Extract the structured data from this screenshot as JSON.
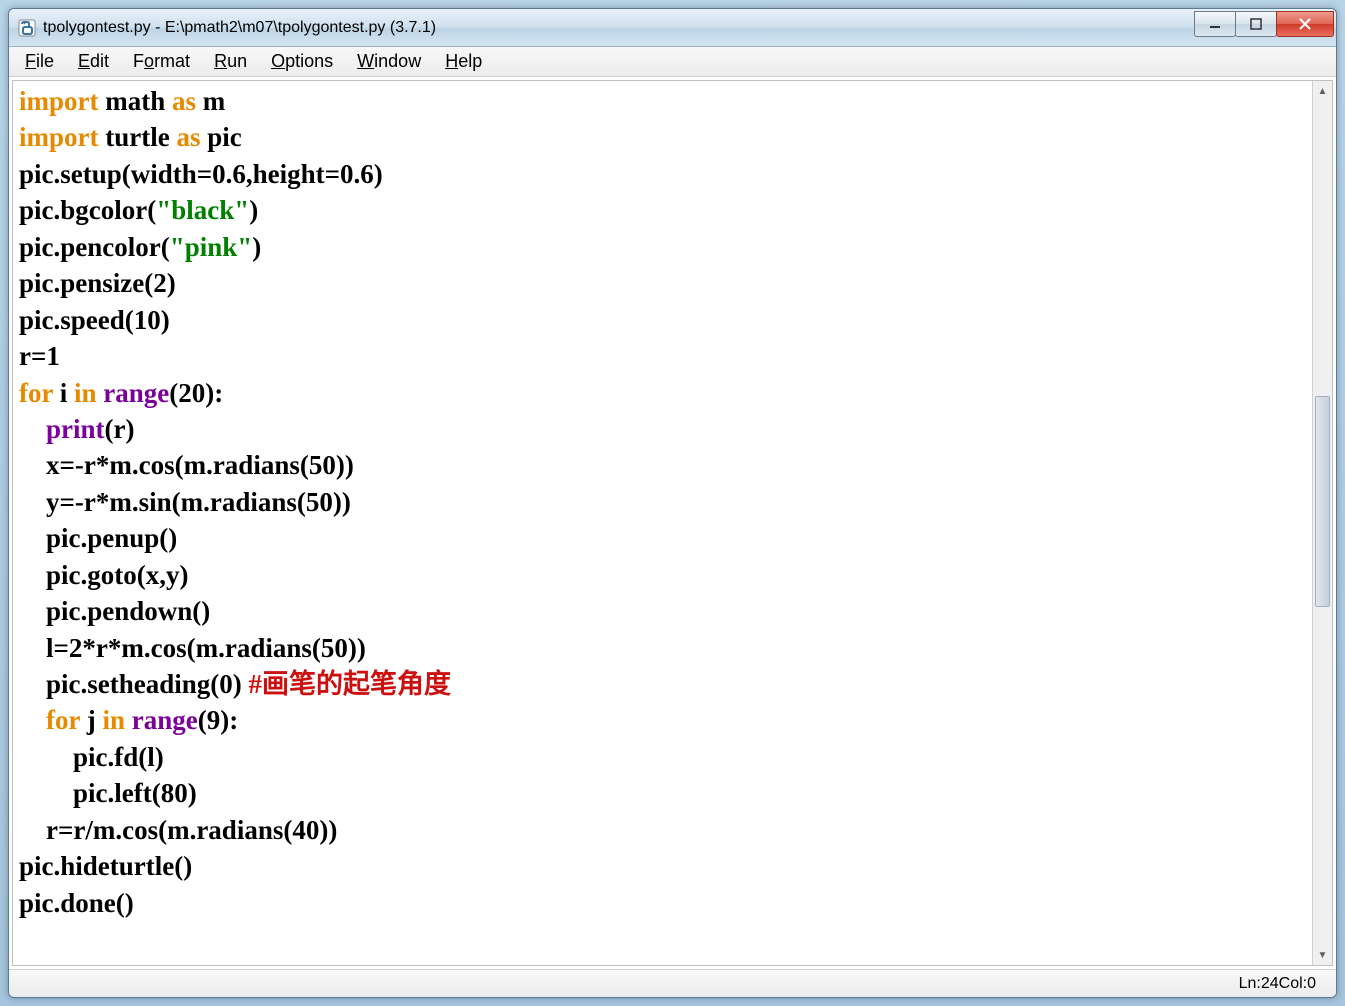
{
  "window": {
    "title": "tpolygontest.py - E:\\pmath2\\m07\\tpolygontest.py (3.7.1)"
  },
  "menu": {
    "file": "File",
    "edit": "Edit",
    "format": "Format",
    "run": "Run",
    "options": "Options",
    "window": "Window",
    "help": "Help"
  },
  "code": {
    "l1_import": "import",
    "l1_math": " math ",
    "l1_as": "as",
    "l1_m": " m",
    "l2_import": "import",
    "l2_turtle": " turtle ",
    "l2_as": "as",
    "l2_pic": " pic",
    "l3": "pic.setup(width=0.6,height=0.6)",
    "l4_a": "pic.bgcolor(",
    "l4_str": "\"black\"",
    "l4_b": ")",
    "l5_a": "pic.pencolor(",
    "l5_str": "\"pink\"",
    "l5_b": ")",
    "l6": "pic.pensize(2)",
    "l7": "pic.speed(10)",
    "l8": "r=1",
    "l9_for": "for",
    "l9_i": " i ",
    "l9_in": "in",
    "l9_sp": " ",
    "l9_range": "range",
    "l9_args": "(20):",
    "l10_indent": "    ",
    "l10_print": "print",
    "l10_args": "(r)",
    "l11": "    x=-r*m.cos(m.radians(50))",
    "l12": "    y=-r*m.sin(m.radians(50))",
    "l13": "    pic.penup()",
    "l14": "    pic.goto(x,y)",
    "l15": "    pic.pendown()",
    "l16": "    l=2*r*m.cos(m.radians(50))",
    "l17_a": "    pic.setheading(0) ",
    "l17_comment": "#画笔的起笔角度",
    "l18_indent": "    ",
    "l18_for": "for",
    "l18_j": " j ",
    "l18_in": "in",
    "l18_sp": " ",
    "l18_range": "range",
    "l18_args": "(9):",
    "l19": "        pic.fd(l)",
    "l20": "        pic.left(80)",
    "l21": "    r=r/m.cos(m.radians(40))",
    "l22": "pic.hideturtle()",
    "l23": "pic.done()"
  },
  "status": {
    "ln_label": "Ln: ",
    "ln_value": "24",
    "col_label": "  Col: ",
    "col_value": "0"
  },
  "colors": {
    "keyword_orange": "#e68a00",
    "builtin_purple": "#7a0099",
    "string_green": "#008000",
    "comment_red": "#cc1010"
  }
}
